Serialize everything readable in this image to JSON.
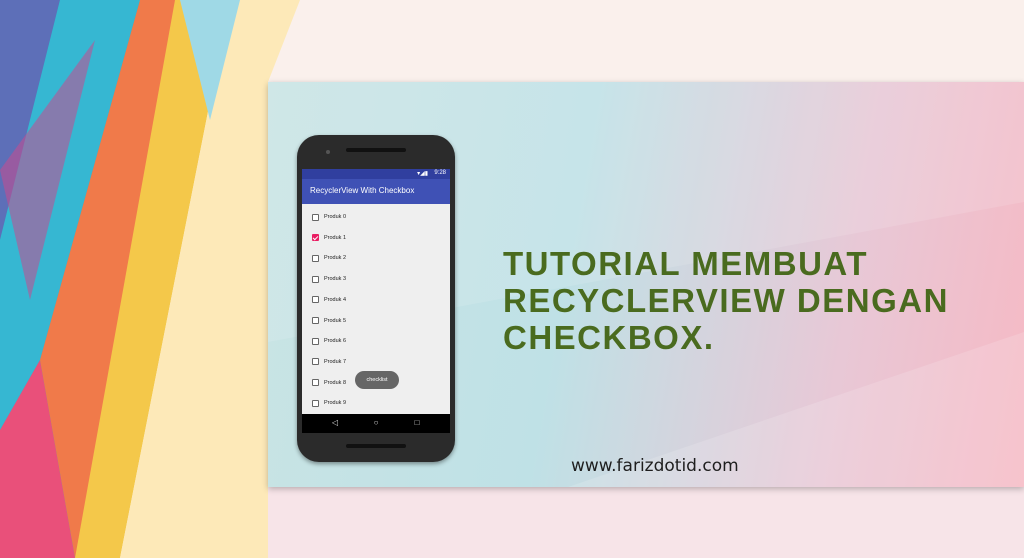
{
  "headline": {
    "line1": "TUTORIAL MEMBUAT",
    "line2": "RECYCLERVIEW DENGAN",
    "line3": "CHECKBOX."
  },
  "website": "www.farizdotid.com",
  "colors": {
    "headline": "#4a6b1f",
    "appbar": "#3f51b5",
    "statusbar": "#303f9f",
    "checkbox_checked": "#e91e63"
  },
  "phone": {
    "status_time": "9:28",
    "app_title": "RecyclerView With Checkbox",
    "items": [
      {
        "label": "Produk 0",
        "checked": false
      },
      {
        "label": "Produk 1",
        "checked": true
      },
      {
        "label": "Produk 2",
        "checked": false
      },
      {
        "label": "Produk 3",
        "checked": false
      },
      {
        "label": "Produk 4",
        "checked": false
      },
      {
        "label": "Produk 5",
        "checked": false
      },
      {
        "label": "Produk 6",
        "checked": false
      },
      {
        "label": "Produk 7",
        "checked": false
      },
      {
        "label": "Produk 8",
        "checked": false
      },
      {
        "label": "Produk 9",
        "checked": false
      }
    ],
    "toast": "checklist",
    "nav_icons": [
      "back-icon",
      "home-icon",
      "recents-icon"
    ]
  }
}
